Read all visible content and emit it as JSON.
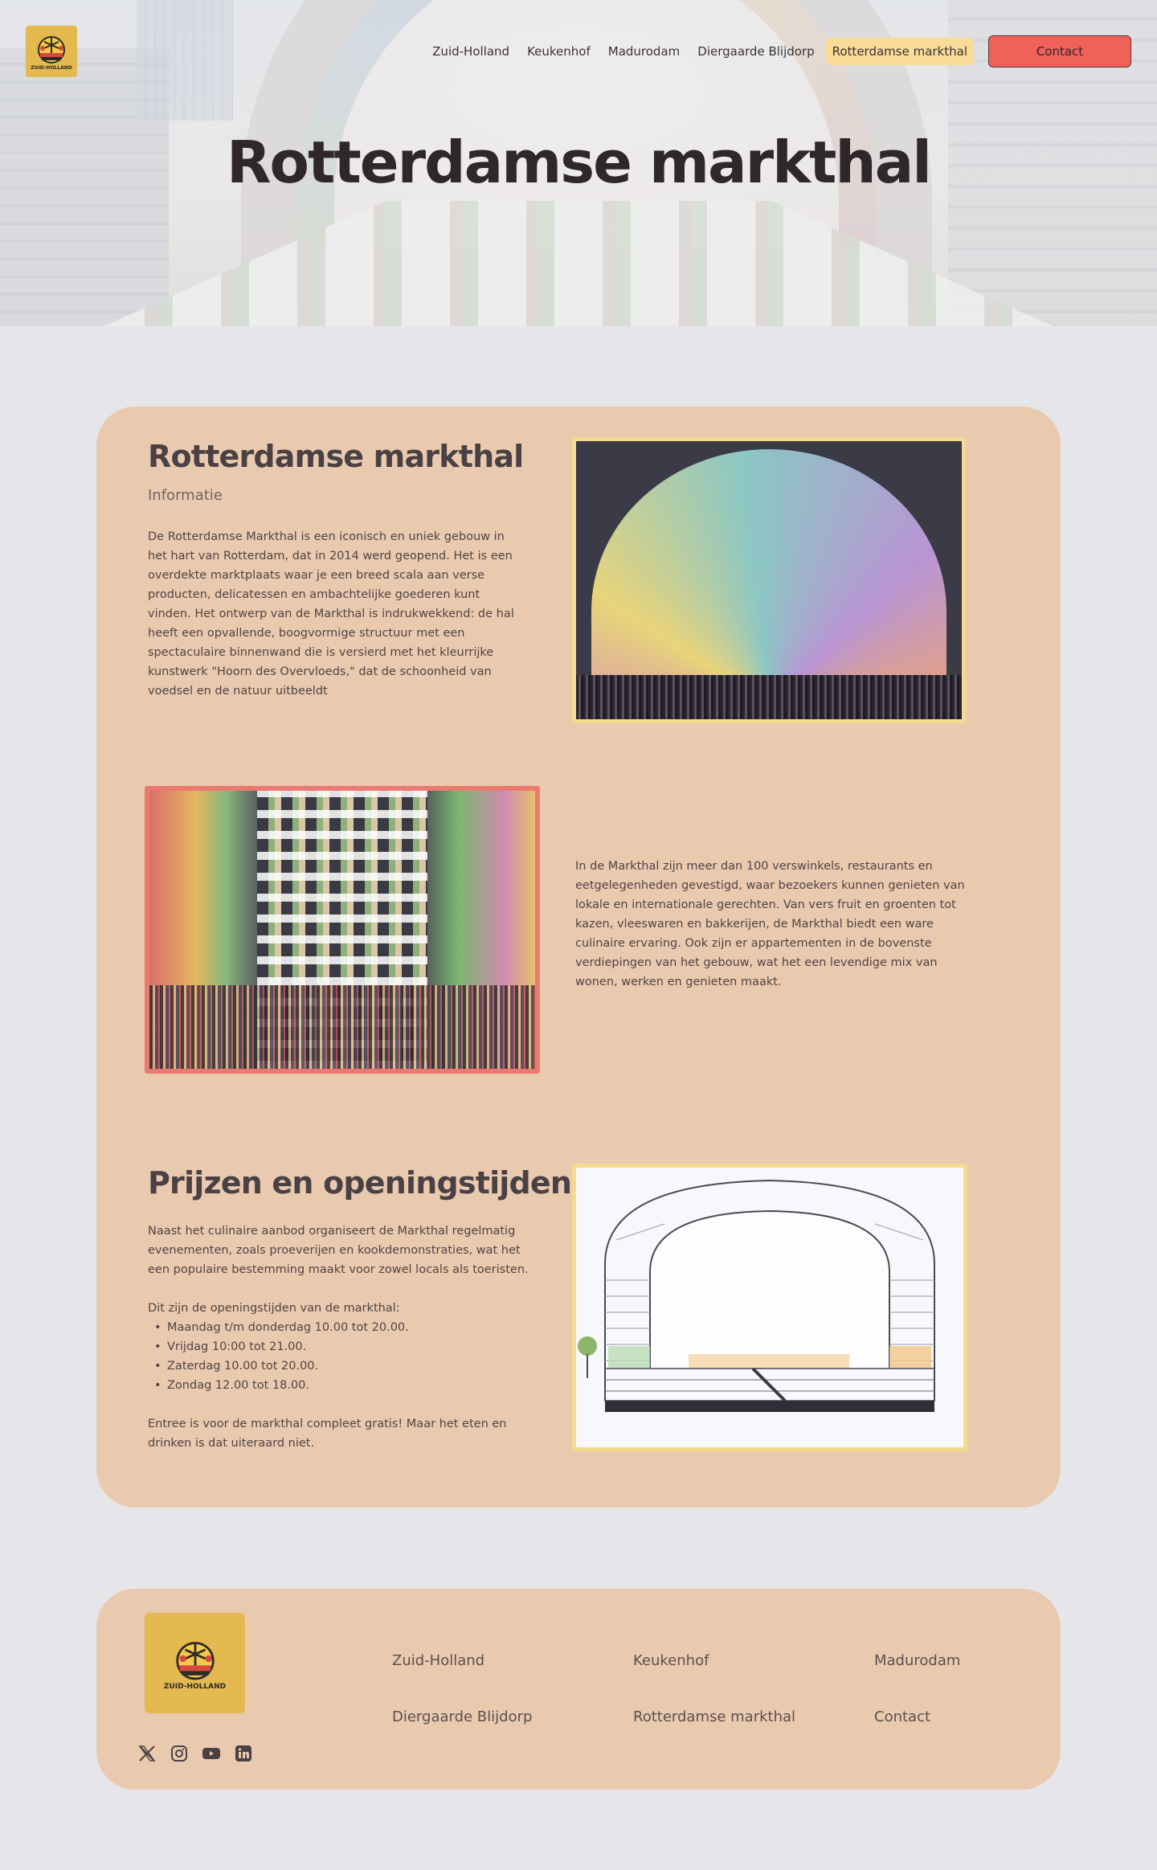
{
  "header": {
    "logo_text": "ZUID-HOLLAND",
    "nav": [
      {
        "label": "Zuid-Holland"
      },
      {
        "label": "Keukenhof"
      },
      {
        "label": "Madurodam"
      },
      {
        "label": "Diergaarde Blijdorp"
      },
      {
        "label": "Rotterdamse markthal",
        "active": true
      }
    ],
    "contact_label": "Contact",
    "hero_title": "Rotterdamse markthal"
  },
  "main": {
    "intro": {
      "title": "Rotterdamse markthal",
      "subtitle": "Informatie",
      "text": "De Rotterdamse Markthal is een iconisch en uniek gebouw in het hart van Rotterdam, dat in 2014 werd geopend. Het is een overdekte marktplaats waar je een breed scala aan verse producten, delicatessen en ambachtelijke goederen kunt vinden. Het ontwerp van de Markthal is indrukwekkend: de hal heeft een opvallende, boogvormige structuur met een spectaculaire binnenwand die is versierd met het kleurrijke kunstwerk \"Hoorn des Overvloeds,\" dat de schoonheid van voedsel en de natuur uitbeeldt"
    },
    "shops": {
      "text": "In de Markthal zijn meer dan 100 verswinkels, restaurants en eetgelegenheden gevestigd, waar bezoekers kunnen genieten van lokale en internationale gerechten. Van vers fruit en groenten tot kazen, vleeswaren en bakkerijen, de Markthal biedt een ware culinaire ervaring. Ook zijn er appartementen in de bovenste verdiepingen van het gebouw, wat het een levendige mix van wonen, werken en genieten maakt."
    },
    "prices": {
      "title": "Prijzen en openingstijden",
      "intro": "Naast het culinaire aanbod organiseert de Markthal regelmatig evenementen, zoals proeverijen en kookdemonstraties, wat het een populaire bestemming maakt voor zowel locals als toeristen.",
      "hours_heading": "Dit zijn de openingstijden van de markthal:",
      "hours": [
        "Maandag t/m donderdag 10.00 tot 20.00.",
        "Vrijdag 10:00 tot 21.00.",
        "Zaterdag 10.00 tot 20.00.",
        "Zondag 12.00 tot 18.00."
      ],
      "note": "Entree is voor de markthal compleet gratis! Maar het eten en drinken is dat uiteraard niet."
    }
  },
  "footer": {
    "logo_text": "ZUID-HOLLAND",
    "links": [
      {
        "label": "Zuid-Holland"
      },
      {
        "label": "Keukenhof"
      },
      {
        "label": "Madurodam"
      },
      {
        "label": "Diergaarde Blijdorp"
      },
      {
        "label": "Rotterdamse markthal"
      },
      {
        "label": "Contact"
      }
    ],
    "socials": [
      "x-icon",
      "instagram-icon",
      "youtube-icon",
      "linkedin-icon"
    ]
  },
  "colors": {
    "page_bg": "#e6e6ea",
    "card_bg": "#eacaae",
    "accent_yellow": "#f9dc97",
    "accent_red": "#f0615a",
    "logo_bg": "#e3b950"
  }
}
